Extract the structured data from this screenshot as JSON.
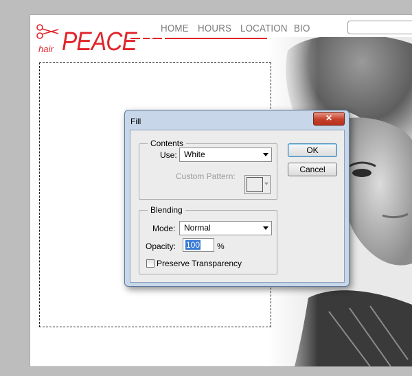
{
  "site": {
    "logo_small": "hair",
    "logo_big": "PEACE",
    "nav": [
      "HOME",
      "HOURS",
      "LOCATION",
      "BIO"
    ],
    "accent_color": "#e0252b"
  },
  "dialog": {
    "title": "Fill",
    "close_icon": "close-x-icon",
    "ok_label": "OK",
    "cancel_label": "Cancel",
    "contents": {
      "legend": "Contents",
      "use_label": "Use:",
      "use_value": "White",
      "pattern_label": "Custom Pattern:"
    },
    "blending": {
      "legend": "Blending",
      "mode_label": "Mode:",
      "mode_value": "Normal",
      "opacity_label": "Opacity:",
      "opacity_value": "100",
      "opacity_unit": "%",
      "preserve_label": "Preserve Transparency",
      "preserve_checked": false
    }
  }
}
